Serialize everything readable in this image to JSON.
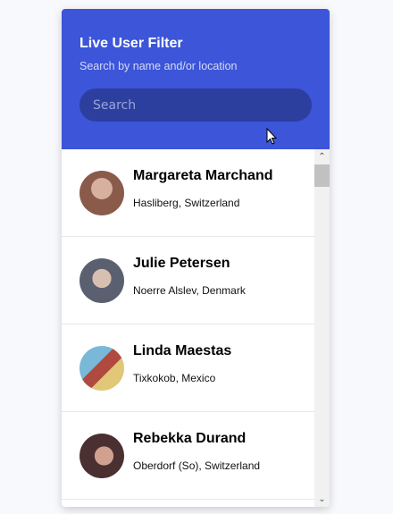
{
  "header": {
    "title": "Live User Filter",
    "subtitle": "Search by name and/or location",
    "search_placeholder": "Search"
  },
  "users": [
    {
      "name": "Margareta Marchand",
      "location": "Hasliberg, Switzerland",
      "avatar_color": "#8a5a4a"
    },
    {
      "name": "Julie Petersen",
      "location": "Noerre Alslev, Denmark",
      "avatar_color": "#6b7080"
    },
    {
      "name": "Linda Maestas",
      "location": "Tixkokob, Mexico",
      "avatar_color": "#c9a860"
    },
    {
      "name": "Rebekka Durand",
      "location": "Oberdorf (So), Switzerland",
      "avatar_color": "#5a4040"
    }
  ]
}
